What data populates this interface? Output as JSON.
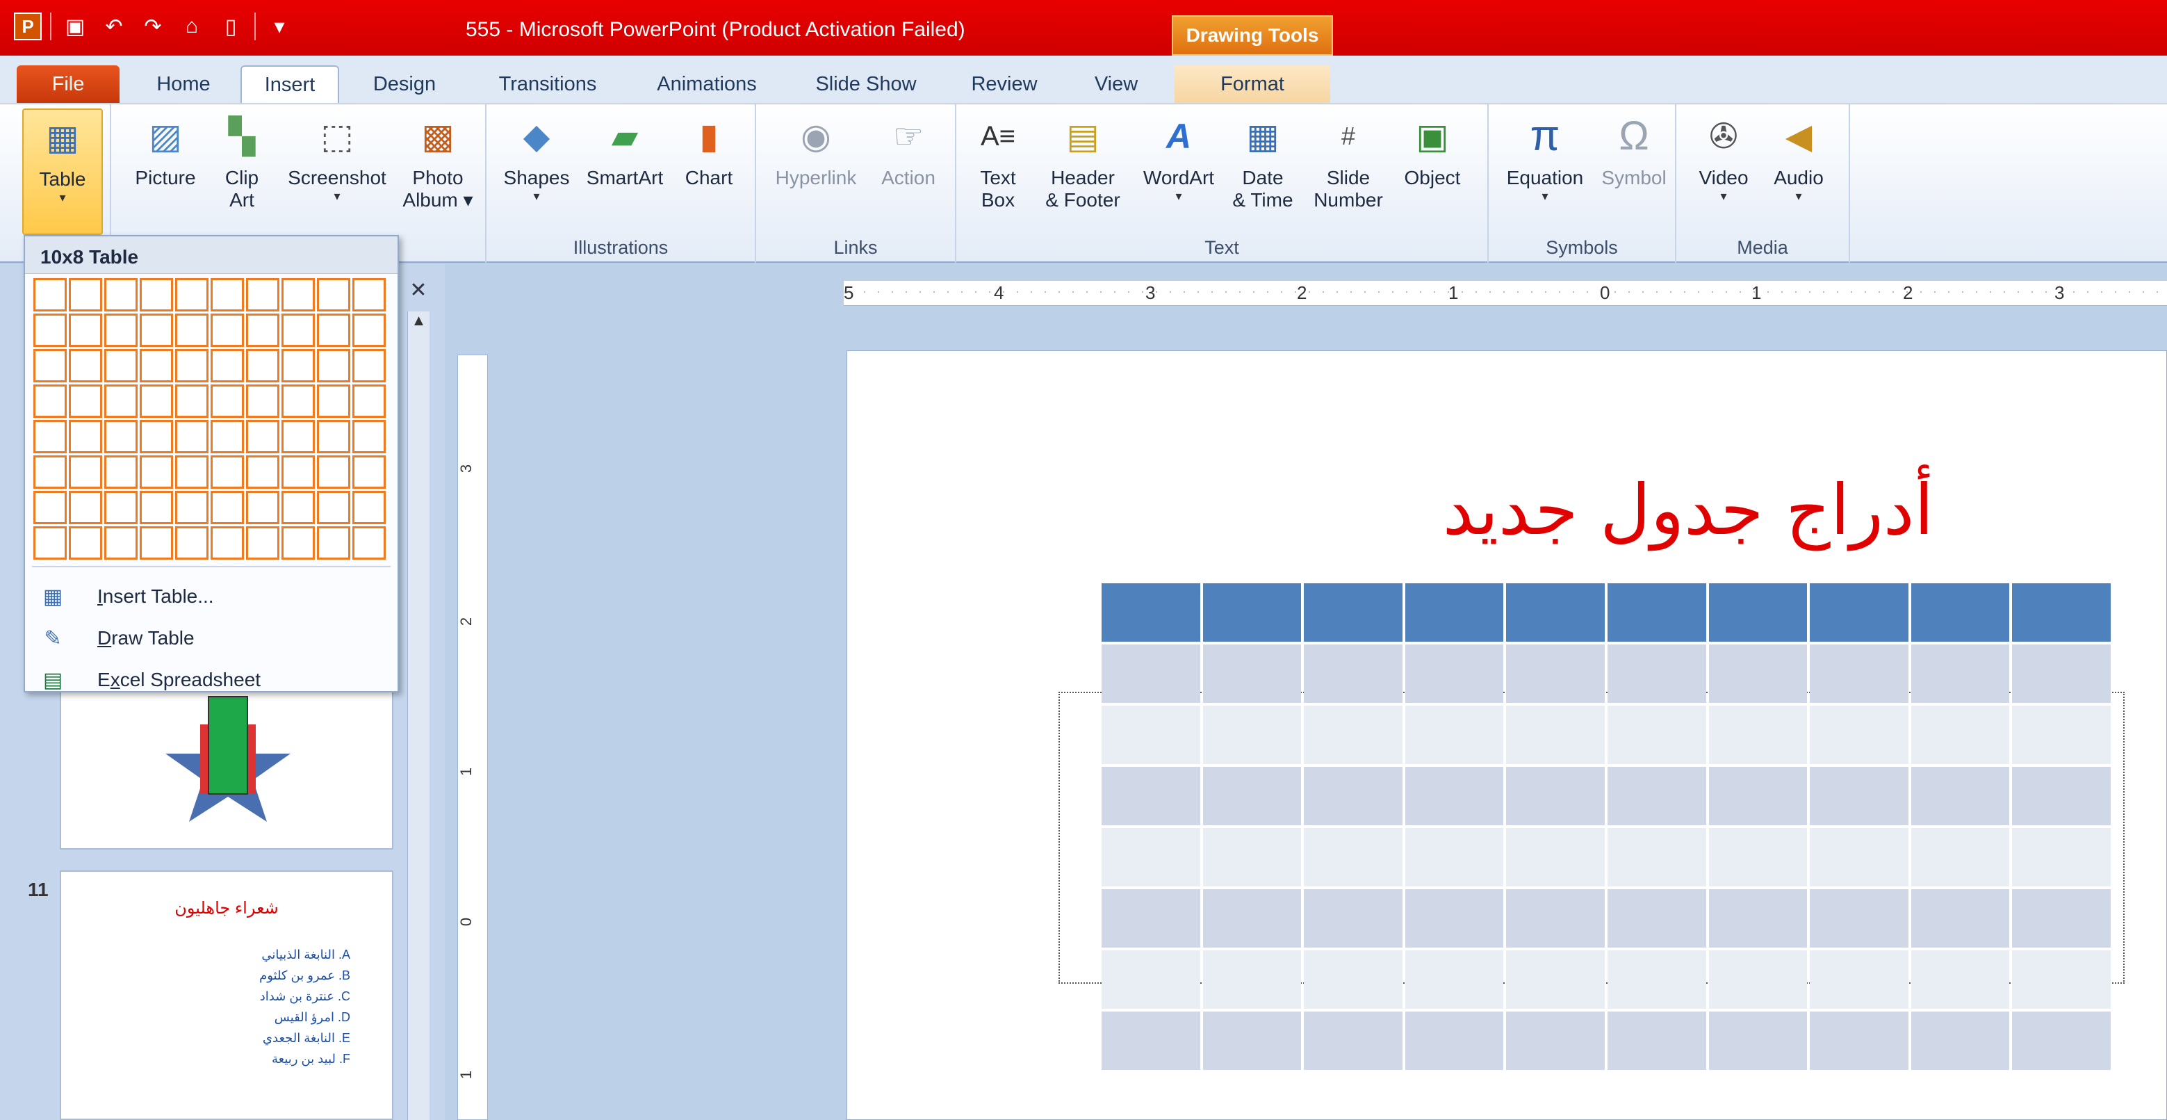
{
  "window": {
    "title": "555 - Microsoft PowerPoint (Product Activation Failed)",
    "contextual_tab_group": "Drawing Tools"
  },
  "qat": {
    "app_icon": "P",
    "icons": [
      "save-icon",
      "undo-icon",
      "redo-icon",
      "open-icon",
      "new-icon",
      "customize-icon"
    ]
  },
  "tabs": [
    {
      "label": "File"
    },
    {
      "label": "Home"
    },
    {
      "label": "Insert"
    },
    {
      "label": "Design"
    },
    {
      "label": "Transitions"
    },
    {
      "label": "Animations"
    },
    {
      "label": "Slide Show"
    },
    {
      "label": "Review"
    },
    {
      "label": "View"
    },
    {
      "label": "Format"
    }
  ],
  "ribbon": {
    "tables": {
      "table_label": "Table"
    },
    "images": {
      "picture": "Picture",
      "clip_art_1": "Clip",
      "clip_art_2": "Art",
      "screenshot": "Screenshot",
      "photo_album_1": "Photo",
      "photo_album_2": "Album"
    },
    "illustrations": {
      "label": "Illustrations",
      "shapes": "Shapes",
      "smartart": "SmartArt",
      "chart": "Chart"
    },
    "links": {
      "label": "Links",
      "hyperlink": "Hyperlink",
      "action": "Action"
    },
    "text": {
      "label": "Text",
      "text_box_1": "Text",
      "text_box_2": "Box",
      "header_1": "Header",
      "header_2": "& Footer",
      "wordart": "WordArt",
      "date_1": "Date",
      "date_2": "& Time",
      "slide_number_1": "Slide",
      "slide_number_2": "Number",
      "object": "Object"
    },
    "symbols": {
      "label": "Symbols",
      "equation": "Equation",
      "symbol": "Symbol"
    },
    "media": {
      "label": "Media",
      "video": "Video",
      "audio": "Audio"
    }
  },
  "table_dropdown": {
    "title": "10x8 Table",
    "columns": 10,
    "rows": 8,
    "items": [
      {
        "pre": "",
        "u": "I",
        "post": "nsert Table...",
        "icon": "insert-table-icon"
      },
      {
        "pre": "",
        "u": "D",
        "post": "raw Table",
        "icon": "draw-table-icon"
      },
      {
        "pre": "E",
        "u": "x",
        "post": "cel Spreadsheet",
        "icon": "excel-icon"
      }
    ]
  },
  "slides_pane": {
    "slide_11": {
      "number": "11",
      "title": "شعراء جاهليون",
      "items": [
        "A.  النابغة الذبياني",
        "B.  عمرو بن كلثوم",
        "C.  عنترة بن شداد",
        "D.  امرؤ القيس",
        "E.  النابغة الجعدي",
        "F.  لبيد بن ربيعة"
      ]
    }
  },
  "rulers": {
    "horizontal": [
      "5",
      "4",
      "3",
      "2",
      "1",
      "0",
      "1",
      "2",
      "3"
    ],
    "vertical": [
      "3",
      "2",
      "1",
      "0",
      "1"
    ]
  },
  "slide": {
    "title": "أدراج جدول جديد",
    "table": {
      "columns": 10,
      "rows": 8
    }
  },
  "colors": {
    "title_bar": "#d60000",
    "file_tab": "#e0501a",
    "table_header": "#4f81bd",
    "table_band_odd": "#d0d8e8",
    "table_band_even": "#e9edf4",
    "grid_cell_border": "#ee7b20",
    "slide_title": "#e00000"
  }
}
